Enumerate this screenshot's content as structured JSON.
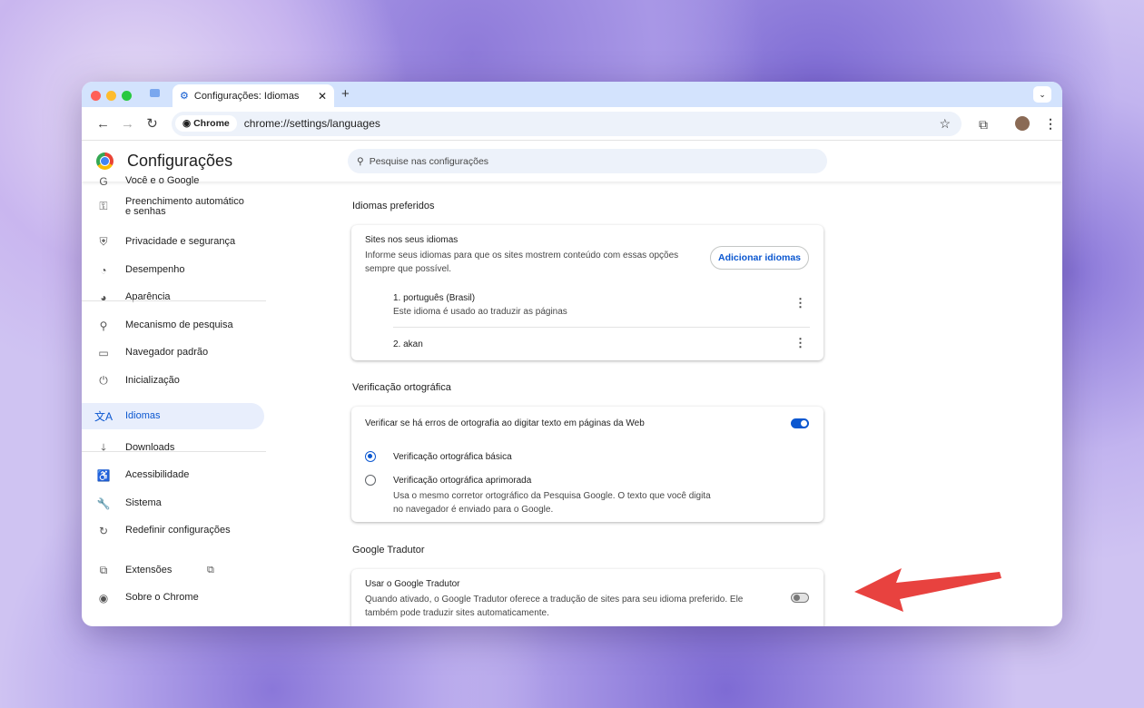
{
  "browser": {
    "tab_title": "Configurações: Idiomas",
    "new_tab": "+",
    "chip": "Chrome",
    "url": "chrome://settings/languages"
  },
  "header": {
    "title": "Configurações",
    "search_placeholder": "Pesquise nas configurações"
  },
  "sidebar": {
    "items": [
      {
        "label": "Você e o Google",
        "icon": "G"
      },
      {
        "label": "Preenchimento automático e senhas",
        "icon": "⚿"
      },
      {
        "label": "Privacidade e segurança",
        "icon": "⛨"
      },
      {
        "label": "Desempenho",
        "icon": "◔"
      },
      {
        "label": "Aparência",
        "icon": "◕"
      },
      {
        "label": "Mecanismo de pesquisa",
        "icon": "⚲"
      },
      {
        "label": "Navegador padrão",
        "icon": "▭"
      },
      {
        "label": "Inicialização",
        "icon": "⏻"
      },
      {
        "label": "Idiomas",
        "icon": "文A"
      },
      {
        "label": "Downloads",
        "icon": "⤓"
      },
      {
        "label": "Acessibilidade",
        "icon": "♿"
      },
      {
        "label": "Sistema",
        "icon": "🔧"
      },
      {
        "label": "Redefinir configurações",
        "icon": "↻"
      },
      {
        "label": "Extensões",
        "icon": "⧉"
      },
      {
        "label": "Sobre o Chrome",
        "icon": "◉"
      }
    ]
  },
  "languages": {
    "section": "Idiomas preferidos",
    "card_title": "Sites nos seus idiomas",
    "card_desc": "Informe seus idiomas para que os sites mostrem conteúdo com essas opções sempre que possível.",
    "add_button": "Adicionar idiomas",
    "list": [
      {
        "name": "1. português (Brasil)",
        "note": "Este idioma é usado ao traduzir as páginas"
      },
      {
        "name": "2. akan"
      }
    ]
  },
  "spell": {
    "section": "Verificação ortográfica",
    "toggle_label": "Verificar se há erros de ortografia ao digitar texto em páginas da Web",
    "toggle_on": true,
    "basic": "Verificação ortográfica básica",
    "enhanced": "Verificação ortográfica aprimorada",
    "enhanced_desc": "Usa o mesmo corretor ortográfico da Pesquisa Google. O texto que você digita no navegador é enviado para o Google.",
    "selected": "basic"
  },
  "translate": {
    "section": "Google Tradutor",
    "title": "Usar o Google Tradutor",
    "desc": "Quando ativado, o Google Tradutor oferece a tradução de sites para seu idioma preferido. Ele também pode traduzir sites automaticamente.",
    "toggle_on": false
  },
  "colors": {
    "accent": "#0b57d0",
    "arrow": "#e8423f"
  }
}
